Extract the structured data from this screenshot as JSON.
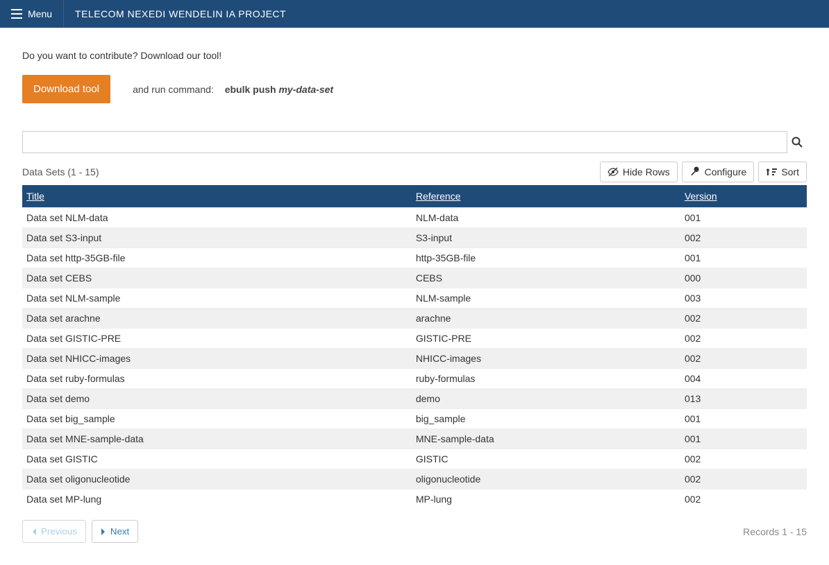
{
  "header": {
    "menu_label": "Menu",
    "app_title": "TELECOM NEXEDI WENDELIN IA PROJECT"
  },
  "intro": {
    "prompt": "Do you want to contribute? Download our tool!",
    "download_button": "Download tool",
    "run_label": "and run command:",
    "command_prefix": "ebulk push ",
    "command_arg": "my-data-set"
  },
  "search": {
    "placeholder": ""
  },
  "listing": {
    "title": "Data Sets (1 - 15)",
    "hide_rows": "Hide Rows",
    "configure": "Configure",
    "sort": "Sort",
    "columns": {
      "title": "Title",
      "reference": "Reference",
      "version": "Version"
    },
    "rows": [
      {
        "title": "Data set NLM-data",
        "reference": "NLM-data",
        "version": "001"
      },
      {
        "title": "Data set S3-input",
        "reference": "S3-input",
        "version": "002"
      },
      {
        "title": "Data set http-35GB-file",
        "reference": "http-35GB-file",
        "version": "001"
      },
      {
        "title": "Data set CEBS",
        "reference": "CEBS",
        "version": "000"
      },
      {
        "title": "Data set NLM-sample",
        "reference": "NLM-sample",
        "version": "003"
      },
      {
        "title": "Data set arachne",
        "reference": "arachne",
        "version": "002"
      },
      {
        "title": "Data set GISTIC-PRE",
        "reference": "GISTIC-PRE",
        "version": "002"
      },
      {
        "title": "Data set NHICC-images",
        "reference": "NHICC-images",
        "version": "002"
      },
      {
        "title": "Data set ruby-formulas",
        "reference": "ruby-formulas",
        "version": "004"
      },
      {
        "title": "Data set demo",
        "reference": "demo",
        "version": "013"
      },
      {
        "title": "Data set big_sample",
        "reference": "big_sample",
        "version": "001"
      },
      {
        "title": "Data set MNE-sample-data",
        "reference": "MNE-sample-data",
        "version": "001"
      },
      {
        "title": "Data set GISTIC",
        "reference": "GISTIC",
        "version": "002"
      },
      {
        "title": "Data set oligonucleotide",
        "reference": "oligonucleotide",
        "version": "002"
      },
      {
        "title": "Data set MP-lung",
        "reference": "MP-lung",
        "version": "002"
      }
    ]
  },
  "footer": {
    "previous": "Previous",
    "next": "Next",
    "records": "Records 1 - 15"
  }
}
